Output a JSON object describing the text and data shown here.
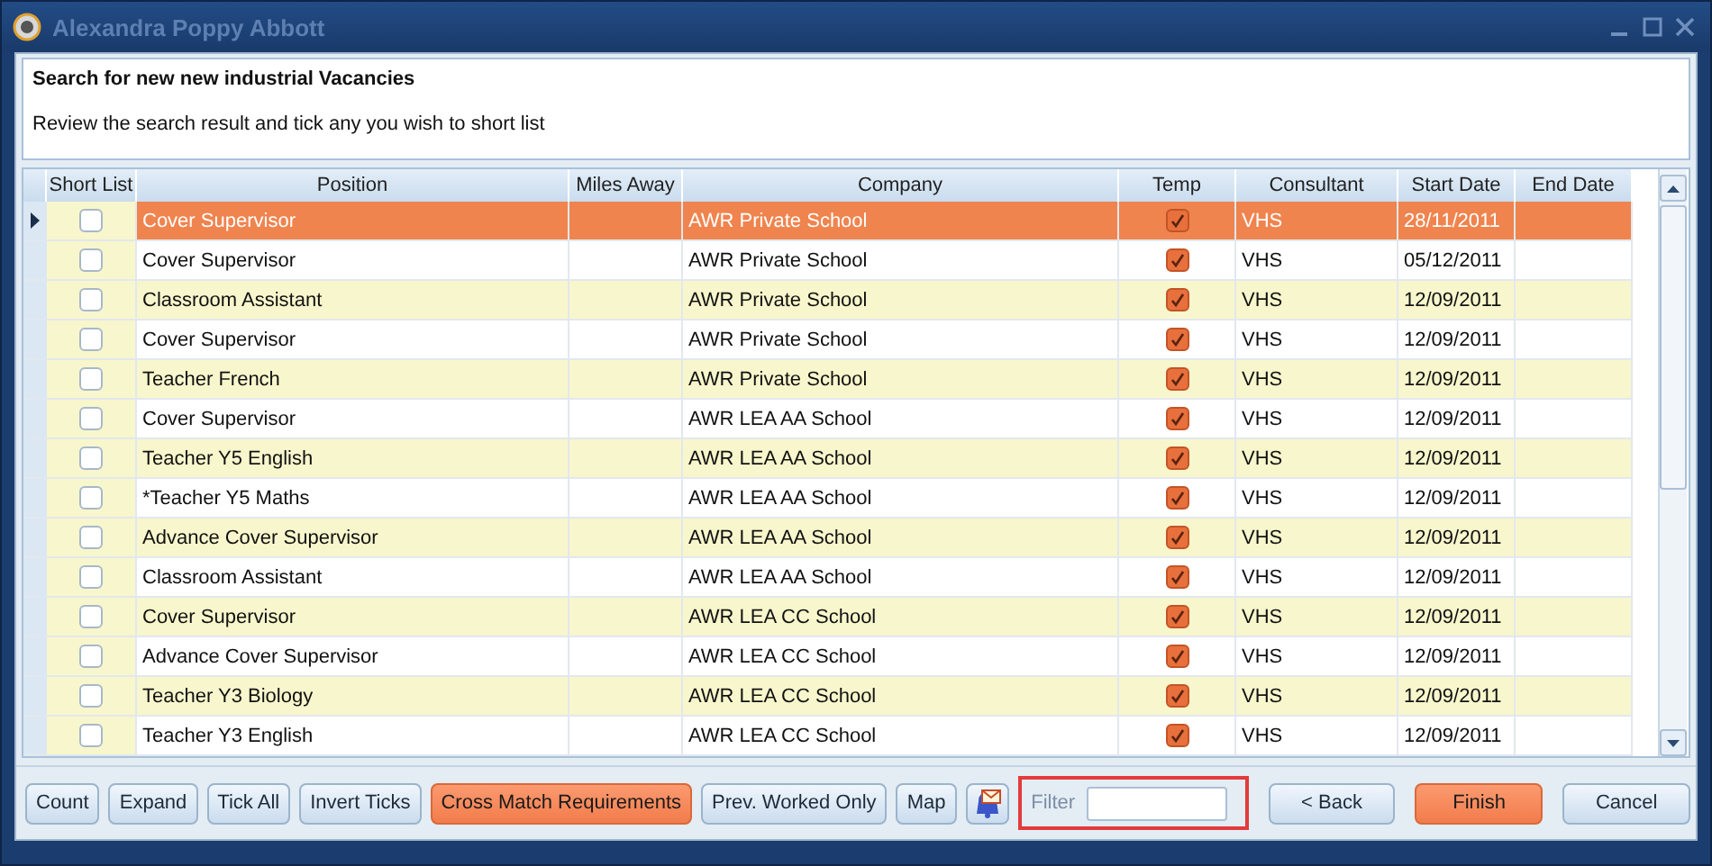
{
  "window": {
    "title": "Alexandra Poppy Abbott"
  },
  "header": {
    "title": "Search for new new industrial Vacancies",
    "instruction": "Review the search result and tick any you wish to short list"
  },
  "grid": {
    "columns": [
      "Short List",
      "Position",
      "Miles Away",
      "Company",
      "Temp",
      "Consultant",
      "Start Date",
      "End Date"
    ],
    "rows": [
      {
        "selected": true,
        "short_list": false,
        "position": "Cover Supervisor",
        "company": "AWR Private School",
        "temp": true,
        "consultant": "VHS",
        "start_date": "28/11/2011"
      },
      {
        "selected": false,
        "short_list": false,
        "position": "Cover Supervisor",
        "company": "AWR Private School",
        "temp": true,
        "consultant": "VHS",
        "start_date": "05/12/2011"
      },
      {
        "selected": false,
        "short_list": false,
        "position": "Classroom Assistant",
        "company": "AWR Private School",
        "temp": true,
        "consultant": "VHS",
        "start_date": "12/09/2011"
      },
      {
        "selected": false,
        "short_list": false,
        "position": "Cover Supervisor",
        "company": "AWR Private School",
        "temp": true,
        "consultant": "VHS",
        "start_date": "12/09/2011"
      },
      {
        "selected": false,
        "short_list": false,
        "position": "Teacher French",
        "company": "AWR Private School",
        "temp": true,
        "consultant": "VHS",
        "start_date": "12/09/2011"
      },
      {
        "selected": false,
        "short_list": false,
        "position": "Cover Supervisor",
        "company": "AWR LEA AA School",
        "temp": true,
        "consultant": "VHS",
        "start_date": "12/09/2011"
      },
      {
        "selected": false,
        "short_list": false,
        "position": "Teacher Y5 English",
        "company": "AWR LEA AA School",
        "temp": true,
        "consultant": "VHS",
        "start_date": "12/09/2011"
      },
      {
        "selected": false,
        "short_list": false,
        "position": "*Teacher Y5 Maths",
        "company": "AWR LEA AA School",
        "temp": true,
        "consultant": "VHS",
        "start_date": "12/09/2011"
      },
      {
        "selected": false,
        "short_list": false,
        "position": "Advance Cover Supervisor",
        "company": "AWR LEA AA School",
        "temp": true,
        "consultant": "VHS",
        "start_date": "12/09/2011"
      },
      {
        "selected": false,
        "short_list": false,
        "position": "Classroom Assistant",
        "company": "AWR LEA AA School",
        "temp": true,
        "consultant": "VHS",
        "start_date": "12/09/2011"
      },
      {
        "selected": false,
        "short_list": false,
        "position": "Cover Supervisor",
        "company": "AWR LEA CC School",
        "temp": true,
        "consultant": "VHS",
        "start_date": "12/09/2011"
      },
      {
        "selected": false,
        "short_list": false,
        "position": "Advance Cover Supervisor",
        "company": "AWR LEA CC School",
        "temp": true,
        "consultant": "VHS",
        "start_date": "12/09/2011"
      },
      {
        "selected": false,
        "short_list": false,
        "position": "Teacher Y3 Biology",
        "company": "AWR LEA CC School",
        "temp": true,
        "consultant": "VHS",
        "start_date": "12/09/2011"
      },
      {
        "selected": false,
        "short_list": false,
        "position": "Teacher Y3 English",
        "company": "AWR LEA CC School",
        "temp": true,
        "consultant": "VHS",
        "start_date": "12/09/2011"
      }
    ]
  },
  "toolbar": {
    "buttons": [
      {
        "kind": "text",
        "label": "Count",
        "highlighted": false
      },
      {
        "kind": "text",
        "label": "Expand",
        "highlighted": false
      },
      {
        "kind": "text",
        "label": "Tick All",
        "highlighted": false
      },
      {
        "kind": "text",
        "label": "Invert Ticks",
        "highlighted": false
      },
      {
        "kind": "text",
        "label": "Cross Match Requirements",
        "highlighted": true
      },
      {
        "kind": "text",
        "label": "Prev. Worked Only",
        "highlighted": false
      },
      {
        "kind": "text",
        "label": "Map",
        "highlighted": false
      },
      {
        "kind": "icon"
      }
    ],
    "filter": {
      "label": "Filter",
      "outlined": true
    },
    "actions": [
      {
        "label": "< Back",
        "highlighted": false
      },
      {
        "label": "Finish",
        "highlighted": true
      },
      {
        "label": "Cancel",
        "highlighted": false
      }
    ]
  }
}
